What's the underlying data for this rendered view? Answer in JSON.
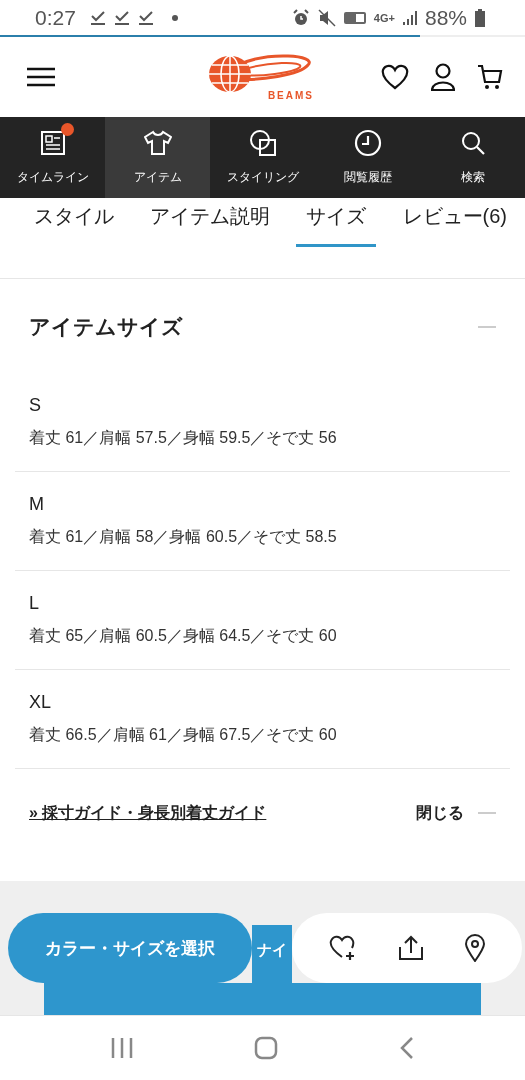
{
  "status_bar": {
    "time": "0:27",
    "network": "4G+",
    "battery": "88%"
  },
  "header": {
    "logo_text": "BEAMS"
  },
  "nav": [
    {
      "label": "タイムライン",
      "badge": true,
      "selected": false
    },
    {
      "label": "アイテム",
      "badge": false,
      "selected": true
    },
    {
      "label": "スタイリング",
      "badge": false,
      "selected": false
    },
    {
      "label": "閲覧履歴",
      "badge": false,
      "selected": false
    },
    {
      "label": "検索",
      "badge": false,
      "selected": false
    }
  ],
  "tabs": [
    {
      "label": "スタイル",
      "selected": false
    },
    {
      "label": "アイテム説明",
      "selected": false
    },
    {
      "label": "サイズ",
      "selected": true
    },
    {
      "label": "レビュー(6)",
      "selected": false
    }
  ],
  "section": {
    "title": "アイテムサイズ",
    "sizes": [
      {
        "size": "S",
        "measurements": "着丈 61／肩幅 57.5／身幅 59.5／そで丈 56"
      },
      {
        "size": "M",
        "measurements": "着丈 61／肩幅 58／身幅 60.5／そで丈 58.5"
      },
      {
        "size": "L",
        "measurements": "着丈 65／肩幅 60.5／身幅 64.5／そで丈 60"
      },
      {
        "size": "XL",
        "measurements": "着丈 66.5／肩幅 61／身幅 67.5／そで丈 60"
      }
    ]
  },
  "guide_link": "» 採寸ガイド・身長別着丈ガイド",
  "close_label": "閉じる",
  "footer": {
    "bar_text": "ナイ",
    "select_button": "カラー・サイズを選択"
  }
}
